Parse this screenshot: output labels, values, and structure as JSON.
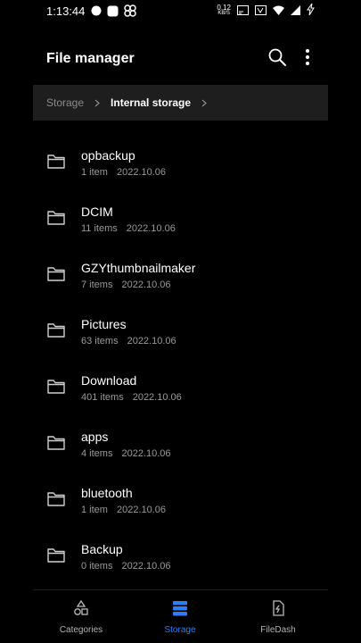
{
  "status_bar": {
    "time": "1:13:44",
    "net_speed_value": "0.12",
    "net_speed_unit": "KB/S",
    "battery_icon": "charging-icon"
  },
  "header": {
    "title": "File manager"
  },
  "breadcrumb": {
    "root": "Storage",
    "current": "Internal storage"
  },
  "folders": [
    {
      "name": "opbackup",
      "count": "1 item",
      "date": "2022.10.06"
    },
    {
      "name": "DCIM",
      "count": "11 items",
      "date": "2022.10.06"
    },
    {
      "name": "GZYthumbnailmaker",
      "count": "7 items",
      "date": "2022.10.06"
    },
    {
      "name": "Pictures",
      "count": "63 items",
      "date": "2022.10.06"
    },
    {
      "name": "Download",
      "count": "401 items",
      "date": "2022.10.06"
    },
    {
      "name": "apps",
      "count": "4 items",
      "date": "2022.10.06"
    },
    {
      "name": "bluetooth",
      "count": "1 item",
      "date": "2022.10.06"
    },
    {
      "name": "Backup",
      "count": "0 items",
      "date": "2022.10.06"
    }
  ],
  "bottom_nav": {
    "items": [
      {
        "label": "Categories",
        "icon": "categories-icon",
        "active": false
      },
      {
        "label": "Storage",
        "icon": "storage-icon",
        "active": true
      },
      {
        "label": "FileDash",
        "icon": "filedash-icon",
        "active": false
      }
    ]
  },
  "colors": {
    "accent": "#2f7cf6",
    "background": "#000000",
    "breadcrumb_bg": "#1e1e1e"
  }
}
